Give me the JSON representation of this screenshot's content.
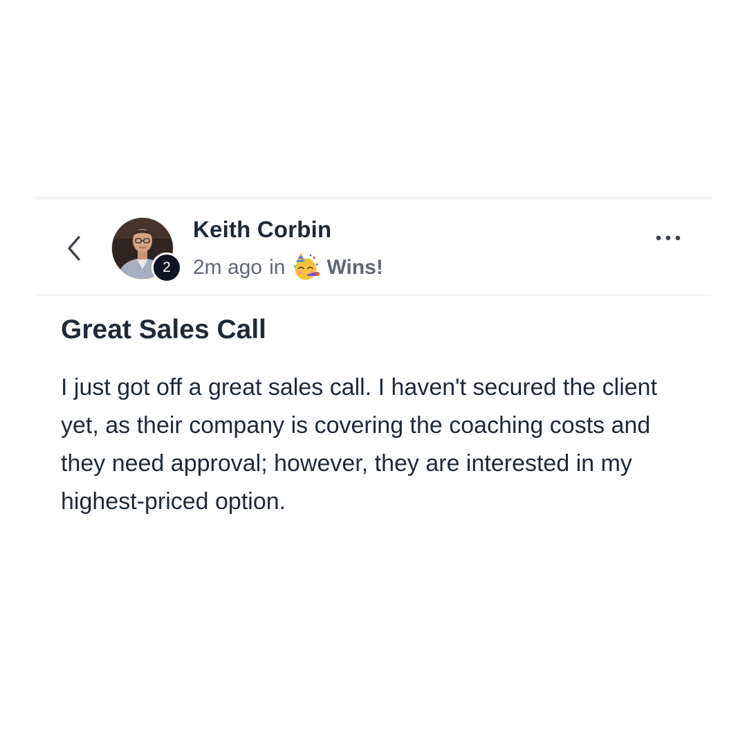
{
  "post": {
    "author": {
      "name": "Keith Corbin",
      "level": "2",
      "avatar_icon": "profile-photo"
    },
    "meta": {
      "time": "2m ago",
      "in_label": "in",
      "category_emoji_icon": "partying-face-icon",
      "category": "Wins!"
    },
    "title": "Great Sales Call",
    "body": "I just got off a great sales call. I haven't secured the client yet, as their company is covering the coaching costs and they need approval; however, they are interested in my highest-priced option."
  },
  "navigation": {
    "back_icon": "chevron-left-icon",
    "more_icon": "more-horizontal-icon"
  },
  "colors": {
    "text_primary": "#1f2937",
    "text_secondary": "#5f6673",
    "badge": "#0e1526",
    "divider": "#e3e5e8"
  }
}
